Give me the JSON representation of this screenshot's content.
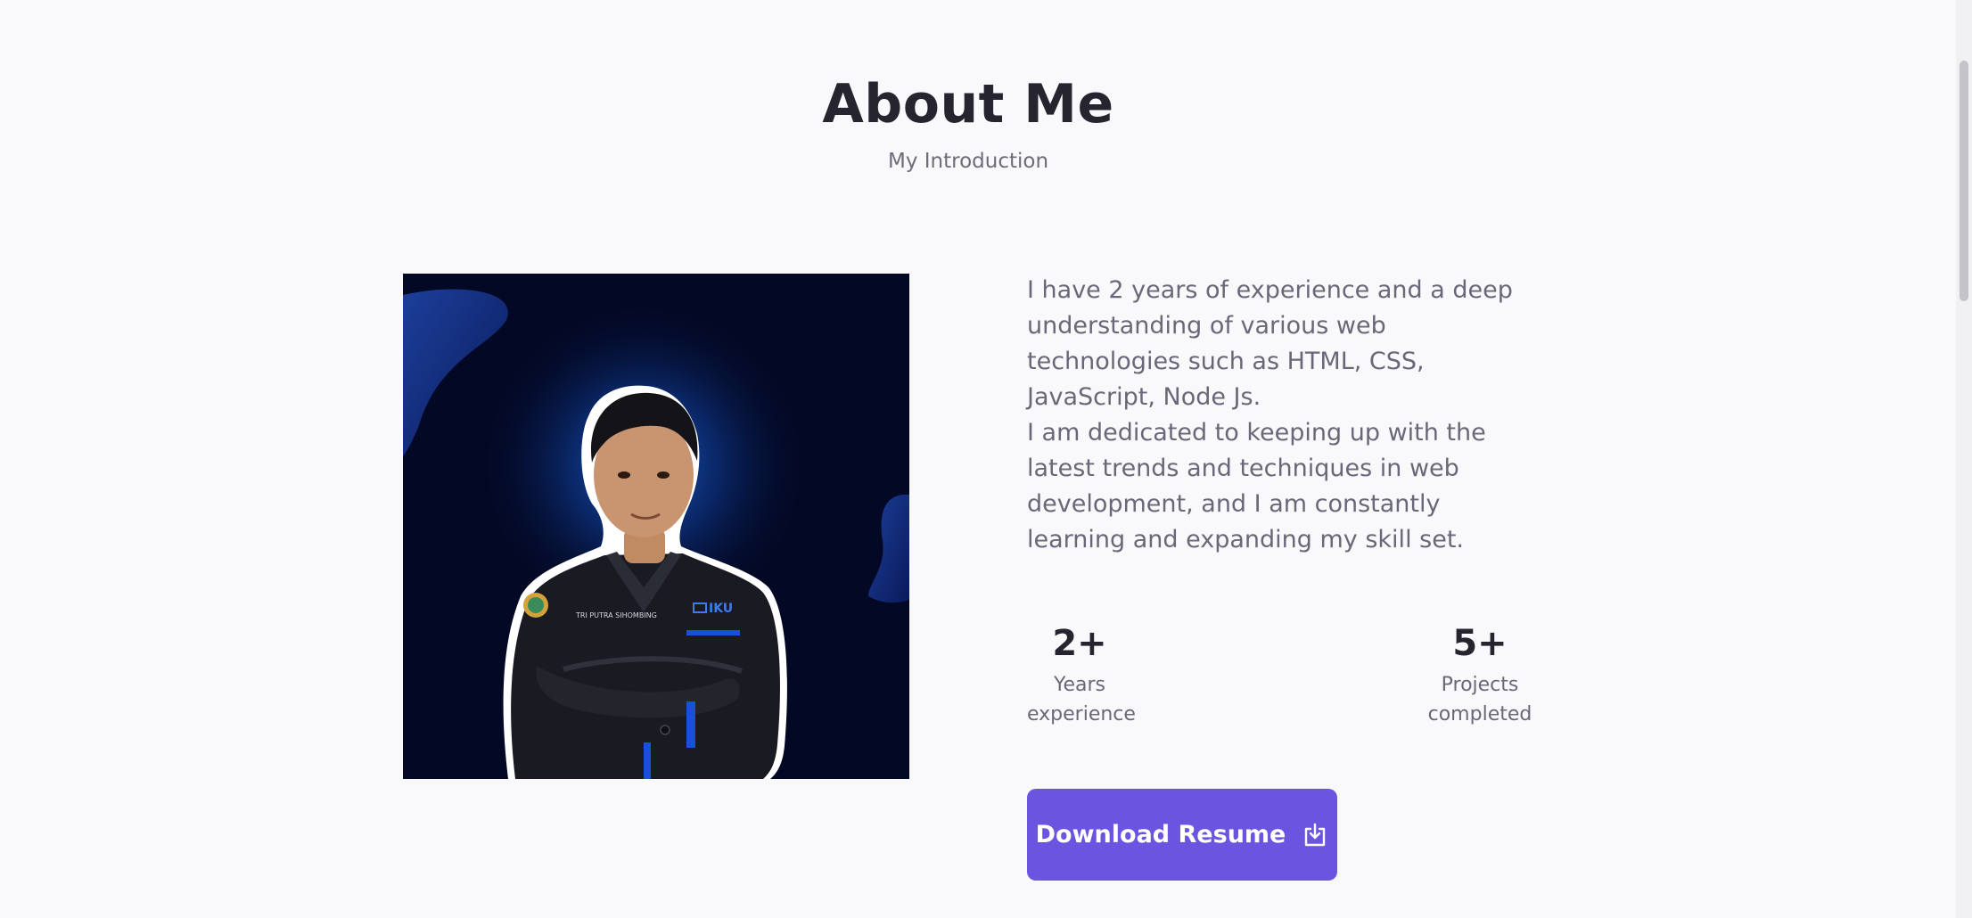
{
  "about": {
    "title": "About Me",
    "subtitle": "My Introduction",
    "paragraph_1": "I have 2 years of experience and a deep understanding of various web technologies such as HTML, CSS, JavaScript, Node Js.",
    "paragraph_2": "I am dedicated to keeping up with the latest trends and techniques in web development, and I am constantly learning and expanding my skill set."
  },
  "photo": {
    "shirt_text": "TRI PUTRA SIHOMBING",
    "badge_text": "IKU"
  },
  "stats": [
    {
      "number": "2+",
      "label_line_1": "Years",
      "label_line_2": "experience"
    },
    {
      "number": "5+",
      "label_line_1": "Projects",
      "label_line_2": "completed"
    }
  ],
  "download_button": {
    "label": "Download Resume",
    "icon": "download-icon"
  },
  "colors": {
    "background": "#f9f9fc",
    "accent": "#6b54e0",
    "title": "#26242e",
    "body_text": "#6a6878",
    "photo_background": "#030824"
  }
}
